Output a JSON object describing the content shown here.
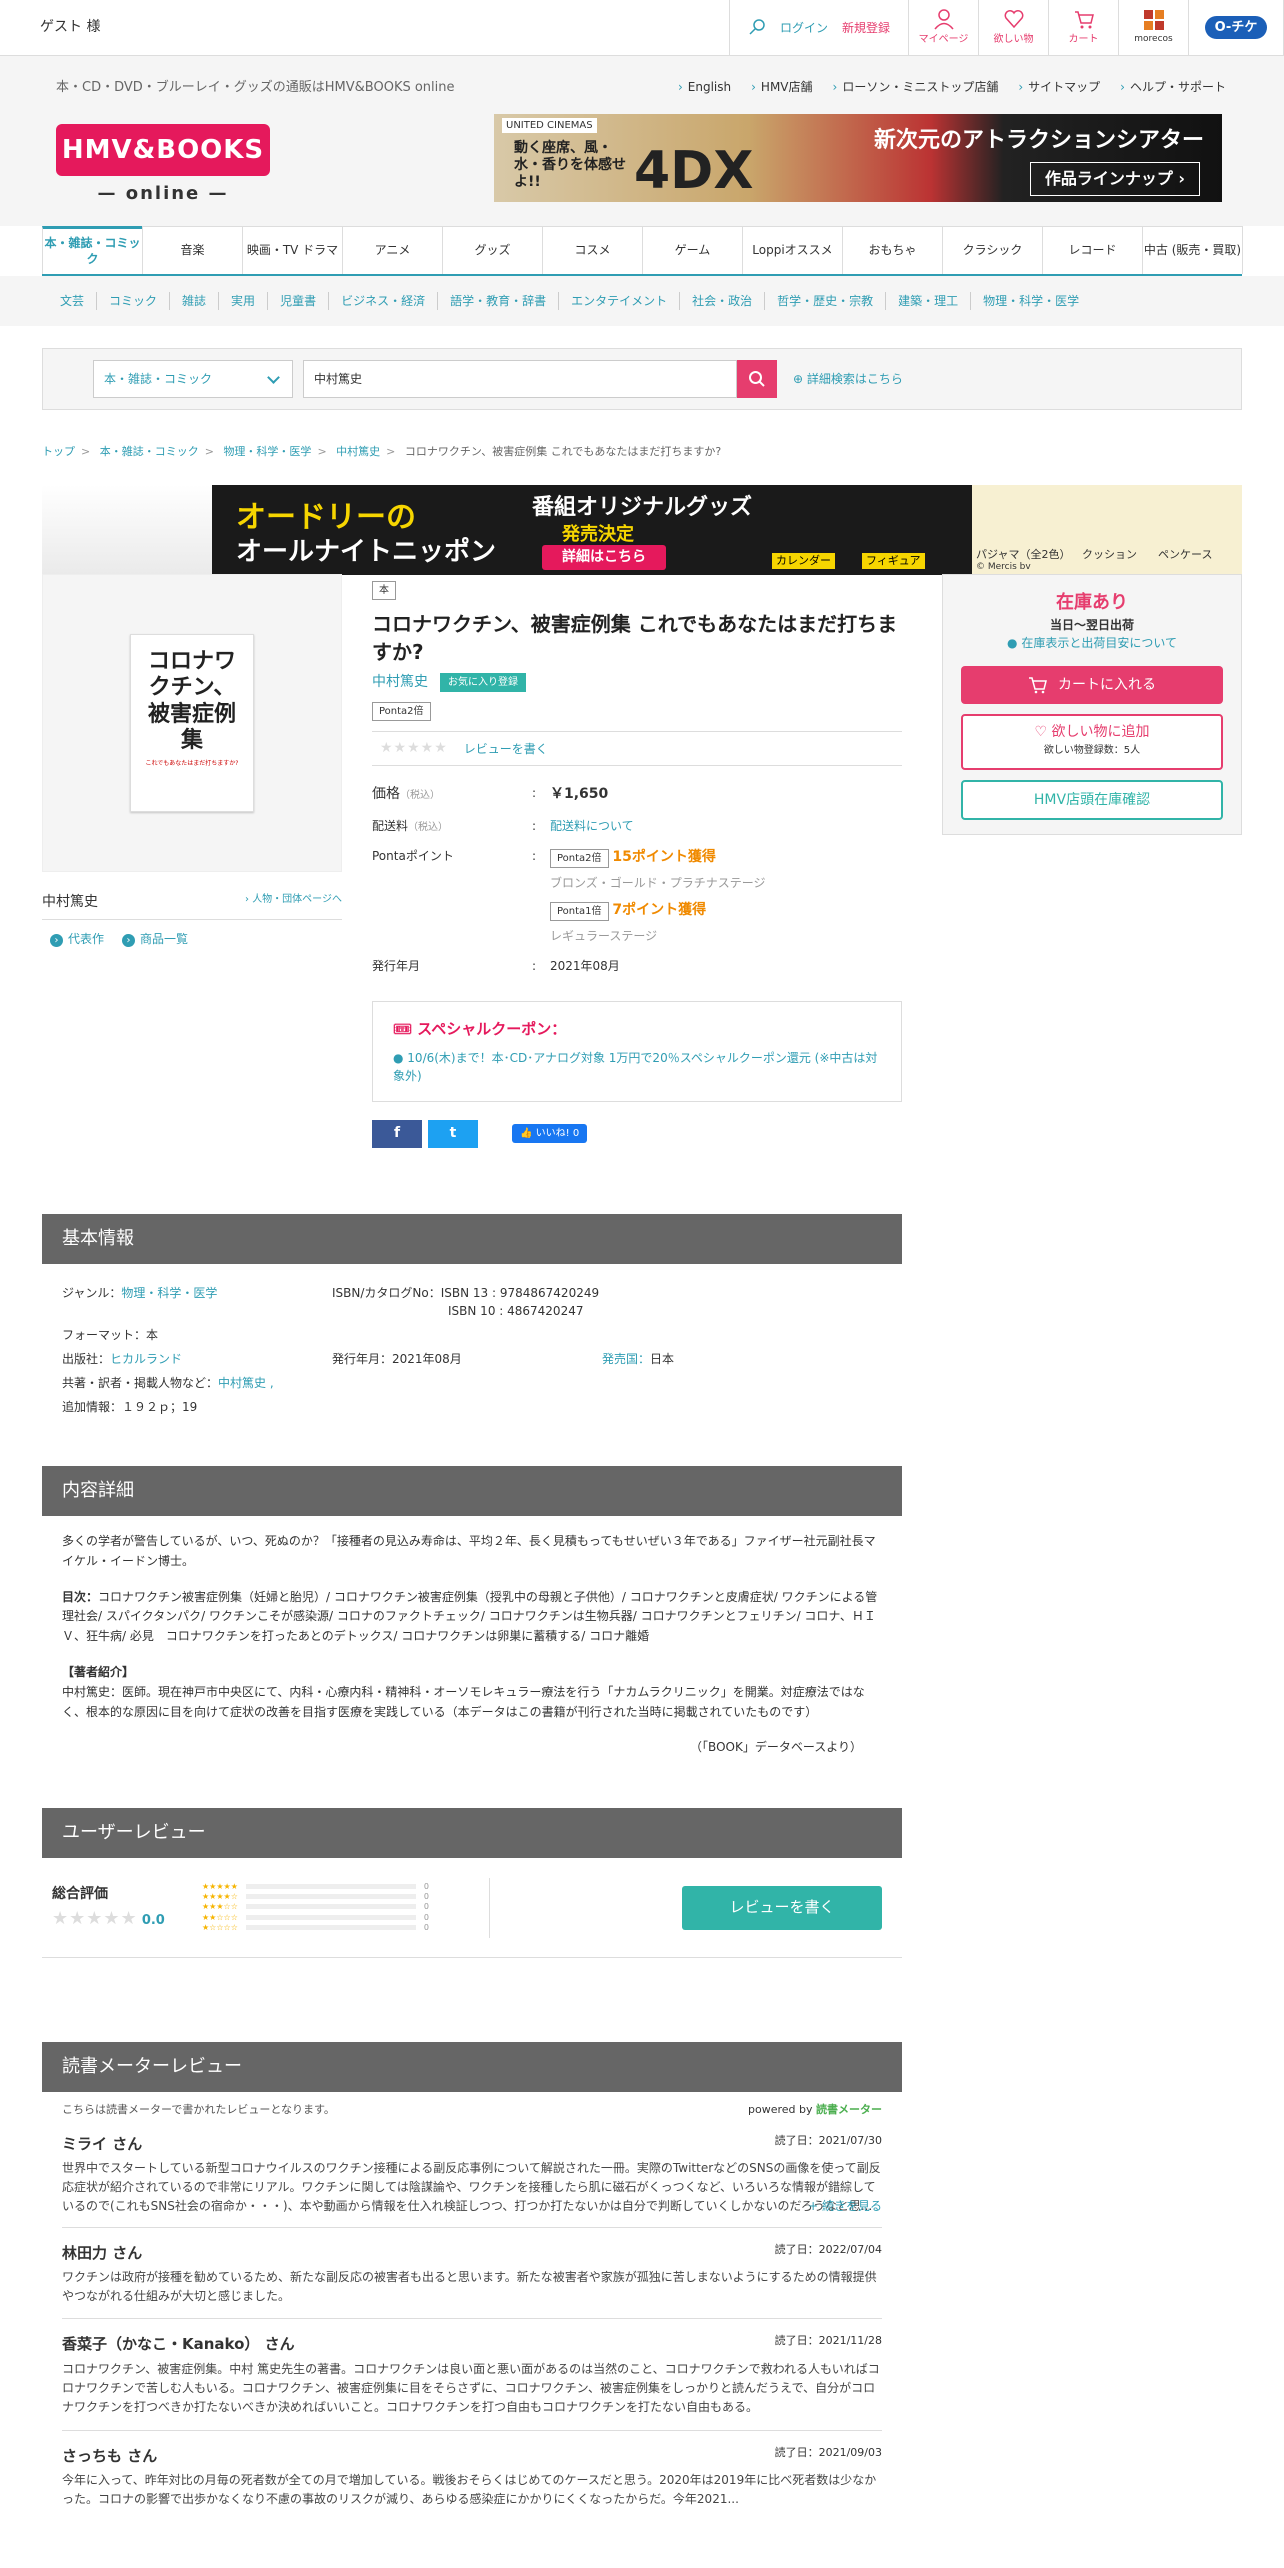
{
  "topbar": {
    "guest": "ゲスト 様",
    "login": "ログイン",
    "register": "新規登録",
    "mypage": "マイページ",
    "wishlist": "欲しい物",
    "cart": "カート",
    "moreco": "morecos",
    "ochike": "O-チケ"
  },
  "header": {
    "tagline": "本・CD・DVD・ブルーレイ・グッズの通販はHMV&BOOKS online",
    "links": [
      "English",
      "HMV店舗",
      "ローソン・ミニストップ店舗",
      "サイトマップ",
      "ヘルプ・サポート"
    ],
    "logo_top": "HMV&BOOKS",
    "logo_bottom": "— online —"
  },
  "banner1": {
    "brand": "UNITED CINEMAS",
    "copy": "動く座席、風・水・香りを体感せよ!!",
    "logo": "4DX",
    "head": "新次元のアトラクションシアター",
    "btn": "作品ラインナップ ›"
  },
  "tabs": [
    {
      "label": "本・雑誌・コミック",
      "active": true
    },
    {
      "label": "音楽"
    },
    {
      "label": "映画・TV ドラマ"
    },
    {
      "label": "アニメ"
    },
    {
      "label": "グッズ"
    },
    {
      "label": "コスメ"
    },
    {
      "label": "ゲーム"
    },
    {
      "label": "Loppiオススメ"
    },
    {
      "label": "おもちゃ"
    },
    {
      "label": "クラシック"
    },
    {
      "label": "レコード"
    },
    {
      "label": "中古 (販売・買取)"
    }
  ],
  "subtabs": [
    "文芸",
    "コミック",
    "雑誌",
    "実用",
    "児童書",
    "ビジネス・経済",
    "語学・教育・辞書",
    "エンタテイメント",
    "社会・政治",
    "哲学・歴史・宗教",
    "建築・理工",
    "物理・科学・医学"
  ],
  "search": {
    "category": "本・雑誌・コミック",
    "query": "中村篤史",
    "advanced": "詳細検索はこちら"
  },
  "breadcrumb": [
    "トップ",
    "本・雑誌・コミック",
    "物理・科学・医学",
    "中村篤史",
    "コロナワクチン、被害症例集 これでもあなたはまだ打ちますか?"
  ],
  "banner2": {
    "line1": "オードリーの",
    "line2": "オールナイトニッポン",
    "line3": "番組オリジナルグッズ",
    "line4": "発売決定",
    "btn": "詳細はこちら",
    "items": [
      "カレンダー",
      "フィギュア",
      "パジャマ（全2色）",
      "クッション",
      "ペンケース"
    ],
    "credit": "© Mercis bv"
  },
  "book": {
    "cover_title": "コロナワクチン、被害症例集",
    "cover_sub": "これでもあなたはまだ打ちますか?",
    "type": "本",
    "title": "コロナワクチン、被害症例集 これでもあなたはまだ打ちますか?",
    "author": "中村篤史",
    "fav": "お気に入り登録",
    "ponta": "Ponta2倍",
    "review_link": "レビューを書く",
    "author_page": "人物・団体ページへ",
    "links": [
      "代表作",
      "商品一覧"
    ]
  },
  "info": {
    "price_label": "価格",
    "tax_in": "（税込）",
    "price": "￥1,650",
    "ship_label": "配送料",
    "ship_val": "配送料について",
    "ponta_label": "Pontaポイント",
    "p2": "Ponta2倍",
    "p2pts": "15ポイント獲得",
    "p2stage": "ブロンズ・ゴールド・プラチナステージ",
    "p1": "Ponta1倍",
    "p1pts": "7ポイント獲得",
    "p1stage": "レギュラーステージ",
    "date_label": "発行年月",
    "date": "2021年08月"
  },
  "coupon": {
    "head": "スペシャルクーポン：",
    "body": "10/6(木)まで！本･CD･アナログ対象 1万円で20％スペシャルクーポン還元 (※中古は対象外)"
  },
  "social": {
    "fb": "f",
    "tw": "t",
    "like": "👍 いいね! 0"
  },
  "side": {
    "stock": "在庫あり",
    "ship": "当日～翌日出荷",
    "stock_link": "在庫表示と出荷目安について",
    "cart": "カートに入れる",
    "wish": "欲しい物に追加",
    "wish_count": "欲しい物登録数：5人",
    "hmv": "HMV店頭在庫確認"
  },
  "basic": {
    "head": "基本情報",
    "genre_k": "ジャンル：",
    "genre": "物理・科学・医学",
    "isbn_k": "ISBN/カタログNo：",
    "isbn13": "ISBN 13 : 9784867420249",
    "isbn10": "ISBN 10 : 4867420247",
    "format": "フォーマット：本",
    "pub_k": "出版社：",
    "pub": "ヒカルランド",
    "date": "発行年月：2021年08月",
    "country_k": "発売国：",
    "country": "日本",
    "co_k": "共著・訳者・掲載人物など：",
    "co": "中村篤史 ,",
    "extra": "追加情報：１９２ｐ；19"
  },
  "detail": {
    "head": "内容詳細",
    "p1": "多くの学者が警告しているが、いつ、死ぬのか？「接種者の見込み寿命は、平均２年、長く見積もってもせいぜい３年である」ファイザー社元副社長マイケル・イードン博士。",
    "toc_k": "目次：",
    "toc": "コロナワクチン被害症例集（妊婦と胎児）/ コロナワクチン被害症例集（授乳中の母親と子供他）/ コロナワクチンと皮膚症状/ ワクチンによる管理社会/ スパイクタンパク/ ワクチンこそが感染源/ コロナのファクトチェック/ コロナワクチンは生物兵器/ コロナワクチンとフェリチン/ コロナ、ＨＩＶ、狂牛病/ 必見　コロナワクチンを打ったあとのデトックス/ コロナワクチンは卵巣に蓄積する/ コロナ離婚",
    "auth_k": "【著者紹介】",
    "auth": "中村篤史：医師。現在神戸市中央区にて、内科・心療内科・精神科・オーソモレキュラー療法を行う「ナカムラクリニック」を開業。対症療法ではなく、根本的な原因に目を向けて症状の改善を目指す医療を実践している（本データはこの書籍が刊行された当時に掲載されていたものです）",
    "src": "（「BOOK」データベースより）"
  },
  "user_review": {
    "head": "ユーザーレビュー",
    "total": "総合評価",
    "score": "0.0",
    "counts": [
      "0",
      "0",
      "0",
      "0",
      "0"
    ],
    "btn": "レビューを書く"
  },
  "dokusho": {
    "head": "読書メーターレビュー",
    "note": "こちらは読書メーターで書かれたレビューとなります。",
    "powered": "powered by",
    "brand": "読書メーター",
    "more": "+ 続きを見る",
    "reviews": [
      {
        "name": "ミライ さん",
        "date": "読了日：2021/07/30",
        "text": "世界中でスタートしている新型コロナウイルスのワクチン接種による副反応事例について解説された一冊。実際のTwitterなどのSNSの画像を使って副反応症状が紹介されているので非常にリアル。ワクチンに関しては陰謀論や、ワクチンを接種したら肌に磁石がくっつくなど、いろいろな情報が錯綜しているので(これもSNS社会の宿命か・・・)、本や動画から情報を仕入れ検証しつつ、打つか打たないかは自分で判断していくしかないのだろうなと思..."
      },
      {
        "name": "林田力 さん",
        "date": "読了日：2022/07/04",
        "text": "ワクチンは政府が接種を勧めているため、新たな副反応の被害者も出ると思います。新たな被害者や家族が孤独に苦しまないようにするための情報提供やつながれる仕組みが大切と感じました。"
      },
      {
        "name": "香菜子（かなこ・Kanako） さん",
        "date": "読了日：2021/11/28",
        "text": "コロナワクチン、被害症例集。中村 篤史先生の著書。コロナワクチンは良い面と悪い面があるのは当然のこと、コロナワクチンで救われる人もいればコロナワクチンで苦しむ人もいる。コロナワクチン、被害症例集に目をそらさずに、コロナワクチン、被害症例集をしっかりと読んだうえで、自分がコロナワクチンを打つべきか打たないべきか決めればいいこと。コロナワクチンを打つ自由もコロナワクチンを打たない自由もある。"
      },
      {
        "name": "さっちも さん",
        "date": "読了日：2021/09/03",
        "text": "今年に入って、昨年対比の月毎の死者数が全ての月で増加している。戦後おそらくはじめてのケースだと思う。2020年は2019年に比べ死者数は少なかった。コロナの影響で出歩かなくなり不慮の事故のリスクが減り、あらゆる感染症にかかりにくくなったからだ。今年2021..."
      }
    ]
  }
}
